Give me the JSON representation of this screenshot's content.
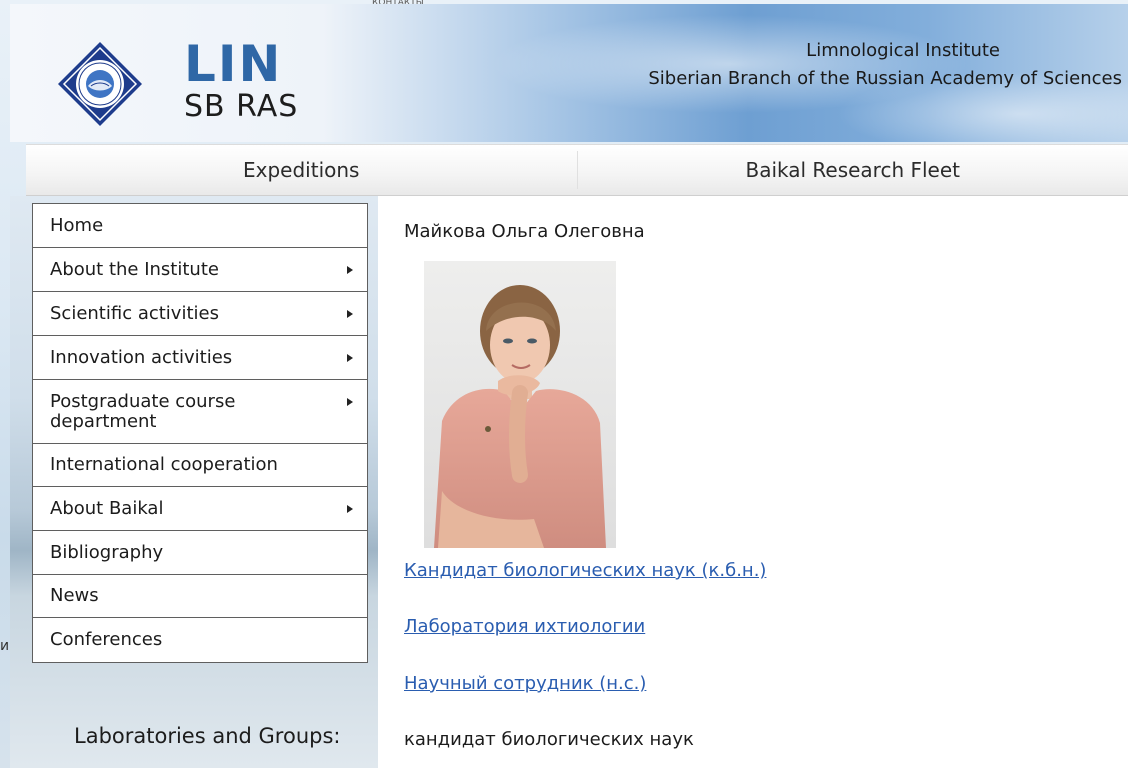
{
  "top_hint": "КОНТАКТЫ",
  "left_edge_mark": "и",
  "header": {
    "logo_main": "LIN",
    "logo_sub": "SB RAS",
    "institute_line1": "Limnological Institute",
    "institute_line2": "Siberian Branch of the Russian Academy of Sciences",
    "emblem_icon": "institute-emblem",
    "colors": {
      "logo_blue": "#2f67a6",
      "emblem_navy": "#1e3c8c"
    }
  },
  "topnav": {
    "items": [
      {
        "label": "Expeditions"
      },
      {
        "label": "Baikal Research Fleet"
      }
    ]
  },
  "sidebar": {
    "items": [
      {
        "label": "Home",
        "has_submenu": false
      },
      {
        "label": "About the Institute",
        "has_submenu": true
      },
      {
        "label": "Scientific activities",
        "has_submenu": true
      },
      {
        "label": "Innovation activities",
        "has_submenu": true
      },
      {
        "label": "Postgraduate course department",
        "has_submenu": true
      },
      {
        "label": "International cooperation",
        "has_submenu": false
      },
      {
        "label": "About Baikal",
        "has_submenu": true
      },
      {
        "label": "Bibliography",
        "has_submenu": false
      },
      {
        "label": "News",
        "has_submenu": false
      },
      {
        "label": "Conferences",
        "has_submenu": false
      }
    ],
    "labs_heading": "Laboratories and Groups:"
  },
  "profile": {
    "name": "Майкова Ольга Олеговна",
    "degree_link": "Кандидат биологических наук (к.б.н.)",
    "lab_link": "Лаборатория ихтиологии",
    "position_link": "Научный сотрудник (н.с.)",
    "degree_text": "кандидат биологических наук",
    "link_color": "#2a5db0"
  }
}
